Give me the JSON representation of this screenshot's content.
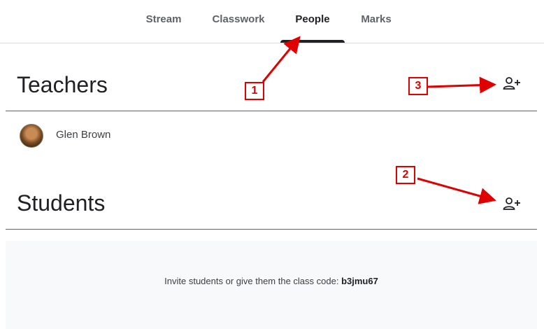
{
  "tabs": [
    {
      "label": "Stream"
    },
    {
      "label": "Classwork"
    },
    {
      "label": "People"
    },
    {
      "label": "Marks"
    }
  ],
  "active_tab": "People",
  "teachers": {
    "title": "Teachers",
    "members": [
      {
        "name": "Glen Brown"
      }
    ]
  },
  "students": {
    "title": "Students",
    "invite_prefix": "Invite students or give them the class code: ",
    "class_code": "b3jmu67"
  },
  "icons": {
    "add_teacher": "person-add-icon",
    "add_student": "person-add-icon"
  },
  "annotations": {
    "callouts": [
      "1",
      "2",
      "3"
    ],
    "color": "#e00000"
  }
}
